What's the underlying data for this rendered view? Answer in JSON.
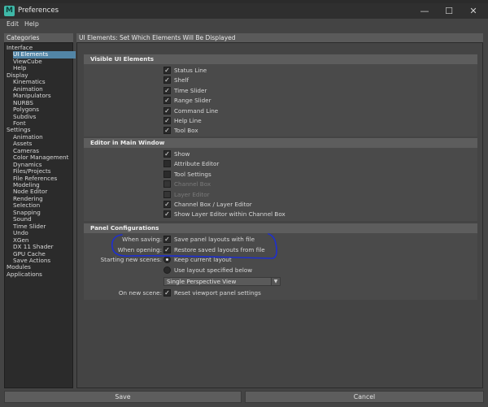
{
  "window": {
    "title": "Preferences",
    "app_icon": "maya-icon",
    "controls": [
      "minimize-icon",
      "maximize-icon",
      "close-icon"
    ]
  },
  "menu": {
    "edit": "Edit",
    "help": "Help"
  },
  "categories": {
    "header": "Categories",
    "items": [
      {
        "label": "Interface",
        "level": 0
      },
      {
        "label": "UI Elements",
        "level": 1,
        "selected": true
      },
      {
        "label": "ViewCube",
        "level": 1
      },
      {
        "label": "Help",
        "level": 1
      },
      {
        "label": "Display",
        "level": 0
      },
      {
        "label": "Kinematics",
        "level": 1
      },
      {
        "label": "Animation",
        "level": 1
      },
      {
        "label": "Manipulators",
        "level": 1
      },
      {
        "label": "NURBS",
        "level": 1
      },
      {
        "label": "Polygons",
        "level": 1
      },
      {
        "label": "Subdivs",
        "level": 1
      },
      {
        "label": "Font",
        "level": 1
      },
      {
        "label": "Settings",
        "level": 0
      },
      {
        "label": "Animation",
        "level": 1
      },
      {
        "label": "Assets",
        "level": 1
      },
      {
        "label": "Cameras",
        "level": 1
      },
      {
        "label": "Color Management",
        "level": 1
      },
      {
        "label": "Dynamics",
        "level": 1
      },
      {
        "label": "Files/Projects",
        "level": 1
      },
      {
        "label": "File References",
        "level": 1
      },
      {
        "label": "Modeling",
        "level": 1
      },
      {
        "label": "Node Editor",
        "level": 1
      },
      {
        "label": "Rendering",
        "level": 1
      },
      {
        "label": "Selection",
        "level": 1
      },
      {
        "label": "Snapping",
        "level": 1
      },
      {
        "label": "Sound",
        "level": 1
      },
      {
        "label": "Time Slider",
        "level": 1
      },
      {
        "label": "Undo",
        "level": 1
      },
      {
        "label": "XGen",
        "level": 1
      },
      {
        "label": "DX 11 Shader",
        "level": 1
      },
      {
        "label": "GPU Cache",
        "level": 1
      },
      {
        "label": "Save Actions",
        "level": 1
      },
      {
        "label": "Modules",
        "level": 0
      },
      {
        "label": "Applications",
        "level": 0
      }
    ]
  },
  "main": {
    "header": "UI Elements: Set Which Elements Will Be Displayed",
    "visible_ui": {
      "title": "Visible UI Elements",
      "options": [
        {
          "label": "Status Line",
          "checked": true
        },
        {
          "label": "Shelf",
          "checked": true
        },
        {
          "label": "Time Slider",
          "checked": true
        },
        {
          "label": "Range Slider",
          "checked": true
        },
        {
          "label": "Command Line",
          "checked": true
        },
        {
          "label": "Help Line",
          "checked": true
        },
        {
          "label": "Tool Box",
          "checked": true
        }
      ]
    },
    "editor_main": {
      "title": "Editor in Main Window",
      "options": [
        {
          "label": "Show",
          "checked": true,
          "disabled": false
        },
        {
          "label": "Attribute Editor",
          "checked": false,
          "disabled": false
        },
        {
          "label": "Tool Settings",
          "checked": false,
          "disabled": false
        },
        {
          "label": "Channel Box",
          "checked": false,
          "disabled": true
        },
        {
          "label": "Layer Editor",
          "checked": false,
          "disabled": true
        },
        {
          "label": "Channel Box / Layer Editor",
          "checked": true,
          "disabled": false
        },
        {
          "label": "Show Layer Editor within Channel Box",
          "checked": true,
          "disabled": false
        }
      ]
    },
    "panel_config": {
      "title": "Panel Configurations",
      "when_saving_label": "When saving:",
      "when_saving_option": "Save panel layouts with file",
      "when_opening_label": "When opening:",
      "when_opening_option": "Restore saved layouts from file",
      "new_scenes_label": "Starting new scenes:",
      "radio_keep": "Keep current layout",
      "radio_use": "Use layout specified below",
      "layout_select_value": "Single Perspective View",
      "on_new_scene_label": "On new scene:",
      "on_new_scene_option": "Reset viewport panel settings"
    }
  },
  "buttons": {
    "save": "Save",
    "cancel": "Cancel"
  },
  "colors": {
    "selection": "#5285a6",
    "annotation_pen": "#1e2fd0"
  }
}
